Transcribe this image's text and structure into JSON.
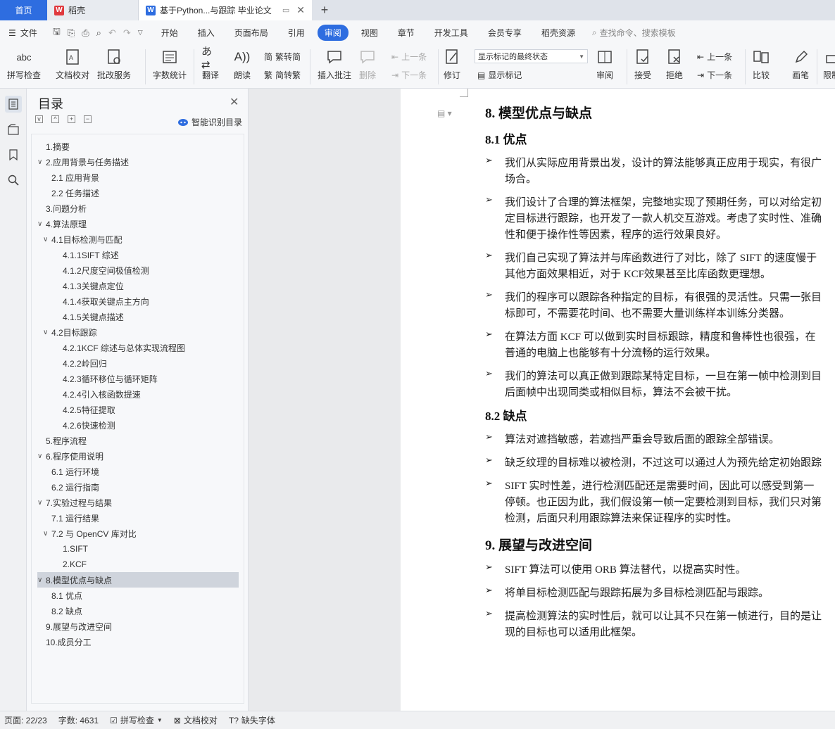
{
  "tabs": {
    "home": "首页",
    "daoke": "稻壳",
    "document": "基于Python...与跟踪 毕业论文"
  },
  "menu": {
    "file": "文件",
    "items": [
      "开始",
      "插入",
      "页面布局",
      "引用",
      "审阅",
      "视图",
      "章节",
      "开发工具",
      "会员专享",
      "稻壳资源"
    ],
    "active": "审阅",
    "search": "查找命令、搜索模板"
  },
  "ribbon": {
    "spell_check": "拼写检查",
    "doc_proof": "文档校对",
    "proof_service": "批改服务",
    "word_count": "字数统计",
    "translate": "翻译",
    "read_aloud": "朗读",
    "trad_conv": "繁转简",
    "simp_conv": "简转繁",
    "insert_comment": "插入批注",
    "delete": "删除",
    "prev_item": "上一条",
    "next_item": "下一条",
    "track_changes": "修订",
    "markup_select": "显示标记的最终状态",
    "show_markup": "显示标记",
    "review": "审阅",
    "accept": "接受",
    "reject": "拒绝",
    "prev_change": "上一条",
    "next_change": "下一条",
    "compare": "比较",
    "draw": "画笔",
    "restrict": "限制"
  },
  "toc": {
    "title": "目录",
    "smart_recognize": "智能识别目录",
    "items": [
      {
        "label": "1.摘要",
        "level": 1,
        "caret": ""
      },
      {
        "label": "2.应用背景与任务描述",
        "level": 1,
        "caret": "v"
      },
      {
        "label": "2.1 应用背景",
        "level": 2,
        "caret": ""
      },
      {
        "label": "2.2 任务描述",
        "level": 2,
        "caret": ""
      },
      {
        "label": "3.问题分析",
        "level": 1,
        "caret": ""
      },
      {
        "label": "4.算法原理",
        "level": 1,
        "caret": "v"
      },
      {
        "label": "4.1目标检测与匹配",
        "level": 2,
        "caret": "v"
      },
      {
        "label": "4.1.1SIFT 综述",
        "level": 3,
        "caret": ""
      },
      {
        "label": "4.1.2尺度空间极值检测",
        "level": 3,
        "caret": ""
      },
      {
        "label": "4.1.3关键点定位",
        "level": 3,
        "caret": ""
      },
      {
        "label": "4.1.4获取关键点主方向",
        "level": 3,
        "caret": ""
      },
      {
        "label": "4.1.5关键点描述",
        "level": 3,
        "caret": ""
      },
      {
        "label": "4.2目标跟踪",
        "level": 2,
        "caret": "v"
      },
      {
        "label": "4.2.1KCF 综述与总体实现流程图",
        "level": 3,
        "caret": ""
      },
      {
        "label": "4.2.2岭回归",
        "level": 3,
        "caret": ""
      },
      {
        "label": "4.2.3循环移位与循环矩阵",
        "level": 3,
        "caret": ""
      },
      {
        "label": "4.2.4引入核函数提速",
        "level": 3,
        "caret": ""
      },
      {
        "label": "4.2.5特征提取",
        "level": 3,
        "caret": ""
      },
      {
        "label": "4.2.6快速检测",
        "level": 3,
        "caret": ""
      },
      {
        "label": "5.程序流程",
        "level": 1,
        "caret": ""
      },
      {
        "label": "6.程序使用说明",
        "level": 1,
        "caret": "v"
      },
      {
        "label": "6.1 运行环境",
        "level": 2,
        "caret": ""
      },
      {
        "label": "6.2 运行指南",
        "level": 2,
        "caret": ""
      },
      {
        "label": "7.实验过程与结果",
        "level": 1,
        "caret": "v"
      },
      {
        "label": "7.1 运行结果",
        "level": 2,
        "caret": ""
      },
      {
        "label": "7.2 与 OpenCV 库对比",
        "level": 2,
        "caret": "v"
      },
      {
        "label": "1.SIFT",
        "level": 3,
        "caret": ""
      },
      {
        "label": "2.KCF",
        "level": 3,
        "caret": ""
      },
      {
        "label": "8.模型优点与缺点",
        "level": 1,
        "caret": "v",
        "selected": true
      },
      {
        "label": "8.1 优点",
        "level": 2,
        "caret": ""
      },
      {
        "label": "8.2 缺点",
        "level": 2,
        "caret": ""
      },
      {
        "label": "9.展望与改进空间",
        "level": 1,
        "caret": ""
      },
      {
        "label": "10.成员分工",
        "level": 1,
        "caret": ""
      }
    ]
  },
  "document": {
    "h8": "8. 模型优点与缺点",
    "h81": "8.1 优点",
    "adv": [
      [
        "我们从实际应用背景出发，设计的算法能够真正应用于现实，有很广",
        "场合。"
      ],
      [
        "我们设计了合理的算法框架，完整地实现了预期任务，可以对给定初",
        "定目标进行跟踪，也开发了一款人机交互游戏。考虑了实时性、准确",
        "性和便于操作性等因素，程序的运行效果良好。"
      ],
      [
        "我们自己实现了算法并与库函数进行了对比，除了 SIFT 的速度慢于",
        "其他方面效果相近，对于 KCF效果甚至比库函数更理想。"
      ],
      [
        "我们的程序可以跟踪各种指定的目标，有很强的灵活性。只需一张目",
        "标即可，不需要花时间、也不需要大量训练样本训练分类器。"
      ],
      [
        "在算法方面 KCF 可以做到实时目标跟踪，精度和鲁棒性也很强，在",
        "普通的电脑上也能够有十分流畅的运行效果。"
      ],
      [
        "我们的算法可以真正做到跟踪某特定目标，一旦在第一帧中检测到目",
        "后面帧中出现同类或相似目标，算法不会被干扰。"
      ]
    ],
    "h82": "8.2 缺点",
    "dis": [
      [
        "算法对遮挡敏感，若遮挡严重会导致后面的跟踪全部错误。"
      ],
      [
        "缺乏纹理的目标难以被检测，不过这可以通过人为预先给定初始跟踪"
      ],
      [
        "SIFT 实时性差，进行检测匹配还是需要时间，因此可以感受到第一",
        "停顿。也正因为此，我们假设第一帧一定要检测到目标，我们只对第",
        "检测，后面只利用跟踪算法来保证程序的实时性。"
      ]
    ],
    "h9": "9. 展望与改进空间",
    "future": [
      [
        "SIFT 算法可以使用 ORB 算法替代，以提高实时性。"
      ],
      [
        "将单目标检测匹配与跟踪拓展为多目标检测匹配与跟踪。"
      ],
      [
        "提高检测算法的实时性后，就可以让其不只在第一帧进行，目的是让",
        "现的目标也可以适用此框架。"
      ]
    ]
  },
  "status": {
    "page": "页面: 22/23",
    "words": "字数: 4631",
    "spell": "拼写检查",
    "proof": "文档校对",
    "missing_font": "缺失字体"
  },
  "colors": {
    "accent": "#2e6de0",
    "daoke_red": "#e0393e"
  }
}
